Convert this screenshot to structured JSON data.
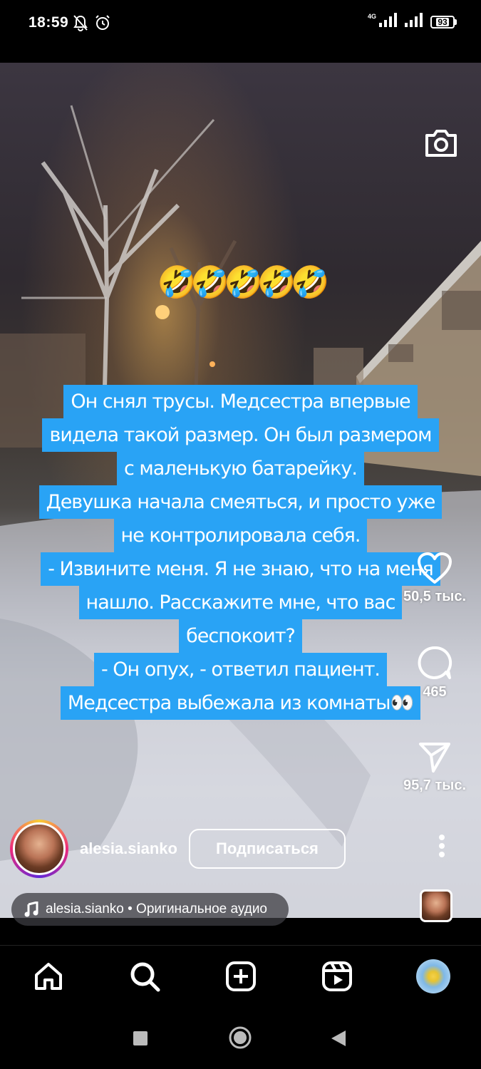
{
  "status_bar": {
    "time": "18:59",
    "network": "4G",
    "battery": "93",
    "icons": [
      "mute-bell-icon",
      "alarm-icon",
      "signal-icon",
      "signal-icon",
      "battery-icon"
    ]
  },
  "reel": {
    "emoji": "🤣🤣🤣🤣🤣",
    "caption_lines": [
      "Он снял трусы. Медсестра впервые",
      "видела такой размер. Он был размером",
      "с маленькую батарейку.",
      "Девушка начала смеяться, и просто уже",
      "не контролировала себя.",
      "- Извините меня. Я не знаю, что на меня",
      "нашло. Расскажите мне, что вас",
      "беспокоит?",
      "- Он опух, - ответил пациент.",
      "Медсестра выбежала из комнаты👀"
    ]
  },
  "actions": {
    "likes": "50,5 тыс.",
    "comments": "465",
    "shares": "95,7 тыс."
  },
  "author": {
    "username": "alesia.sianko",
    "follow_label": "Подписаться"
  },
  "audio": {
    "text": "alesia.sianko • Оригинальное аудио"
  },
  "tabbar": {
    "items": [
      "home-icon",
      "search-icon",
      "create-icon",
      "reels-icon",
      "profile-avatar"
    ]
  },
  "system_nav": [
    "recents-button",
    "home-button",
    "back-button"
  ]
}
